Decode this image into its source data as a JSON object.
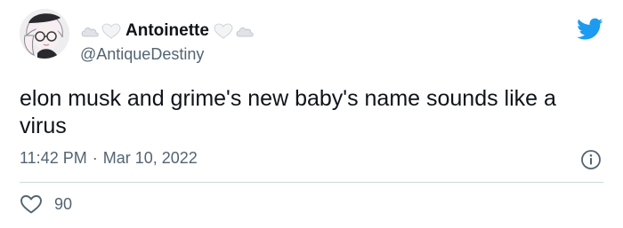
{
  "tweet": {
    "display_name": "Antoinette",
    "handle": "@AntiqueDestiny",
    "text": "elon musk and grime's new baby's name sounds like a virus",
    "time": "11:42 PM",
    "separator": "·",
    "date": "Mar 10, 2022",
    "likes": "90"
  },
  "icons": {
    "name_prefix": [
      "cloud-icon",
      "white-heart-icon"
    ],
    "name_suffix": [
      "white-heart-icon",
      "cloud-icon"
    ],
    "brand": "twitter-bird-icon",
    "info": "info-icon",
    "like": "heart-outline-icon"
  },
  "colors": {
    "twitter_blue": "#1d9bf0",
    "text_primary": "#0f1419",
    "text_secondary": "#536471",
    "divider": "#cfd9de"
  }
}
